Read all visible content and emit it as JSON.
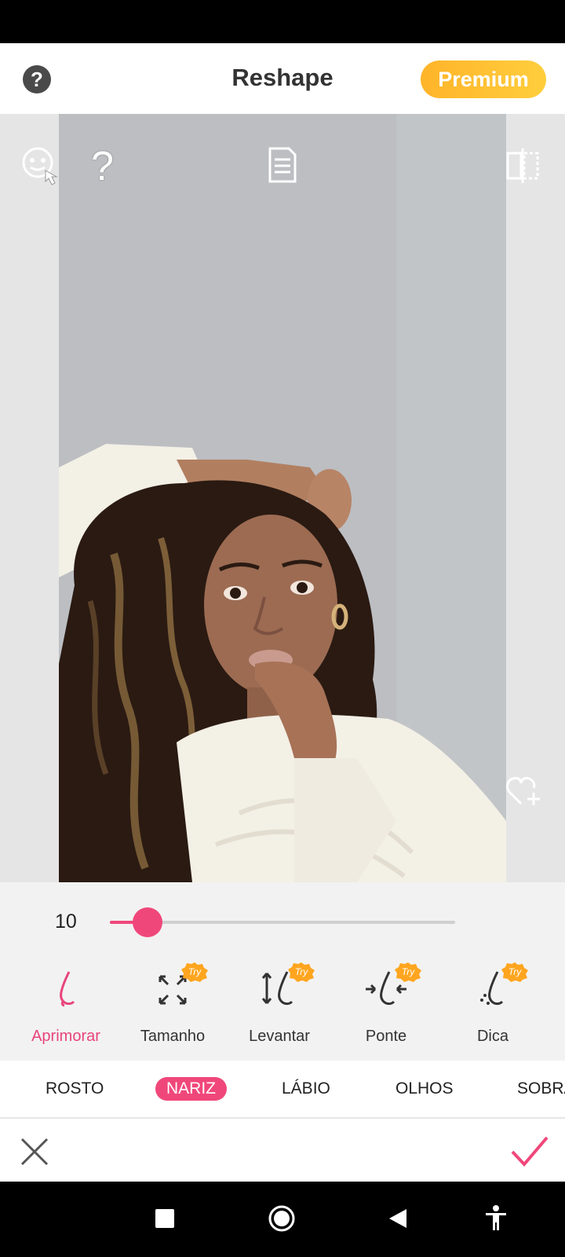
{
  "header": {
    "help_label": "?",
    "title": "Reshape",
    "premium_label": "Premium"
  },
  "canvas": {
    "icons": [
      "face-touch-icon",
      "help-outline-icon",
      "document-icon",
      "compare-icon",
      "favorite-add-icon"
    ]
  },
  "slider": {
    "value": "10",
    "fraction": 0.11
  },
  "tools": [
    {
      "label": "Aprimorar",
      "icon": "nose-enhance-icon",
      "try": false,
      "active": true
    },
    {
      "label": "Tamanho",
      "icon": "resize-arrows-icon",
      "try": true,
      "active": false
    },
    {
      "label": "Levantar",
      "icon": "nose-lift-icon",
      "try": true,
      "active": false
    },
    {
      "label": "Ponte",
      "icon": "nose-bridge-icon",
      "try": true,
      "active": false
    },
    {
      "label": "Dica",
      "icon": "nose-tip-icon",
      "try": true,
      "active": false
    }
  ],
  "try_badge": "Try",
  "tabs": [
    {
      "label": "ROSTO",
      "active": false
    },
    {
      "label": "NARIZ",
      "active": true
    },
    {
      "label": "LÁBIO",
      "active": false
    },
    {
      "label": "OLHOS",
      "active": false
    },
    {
      "label": "SOBRA",
      "active": false
    }
  ],
  "colors": {
    "accent": "#f0477a",
    "premium": "#ffbf33",
    "try_badge": "#ffa51f"
  }
}
